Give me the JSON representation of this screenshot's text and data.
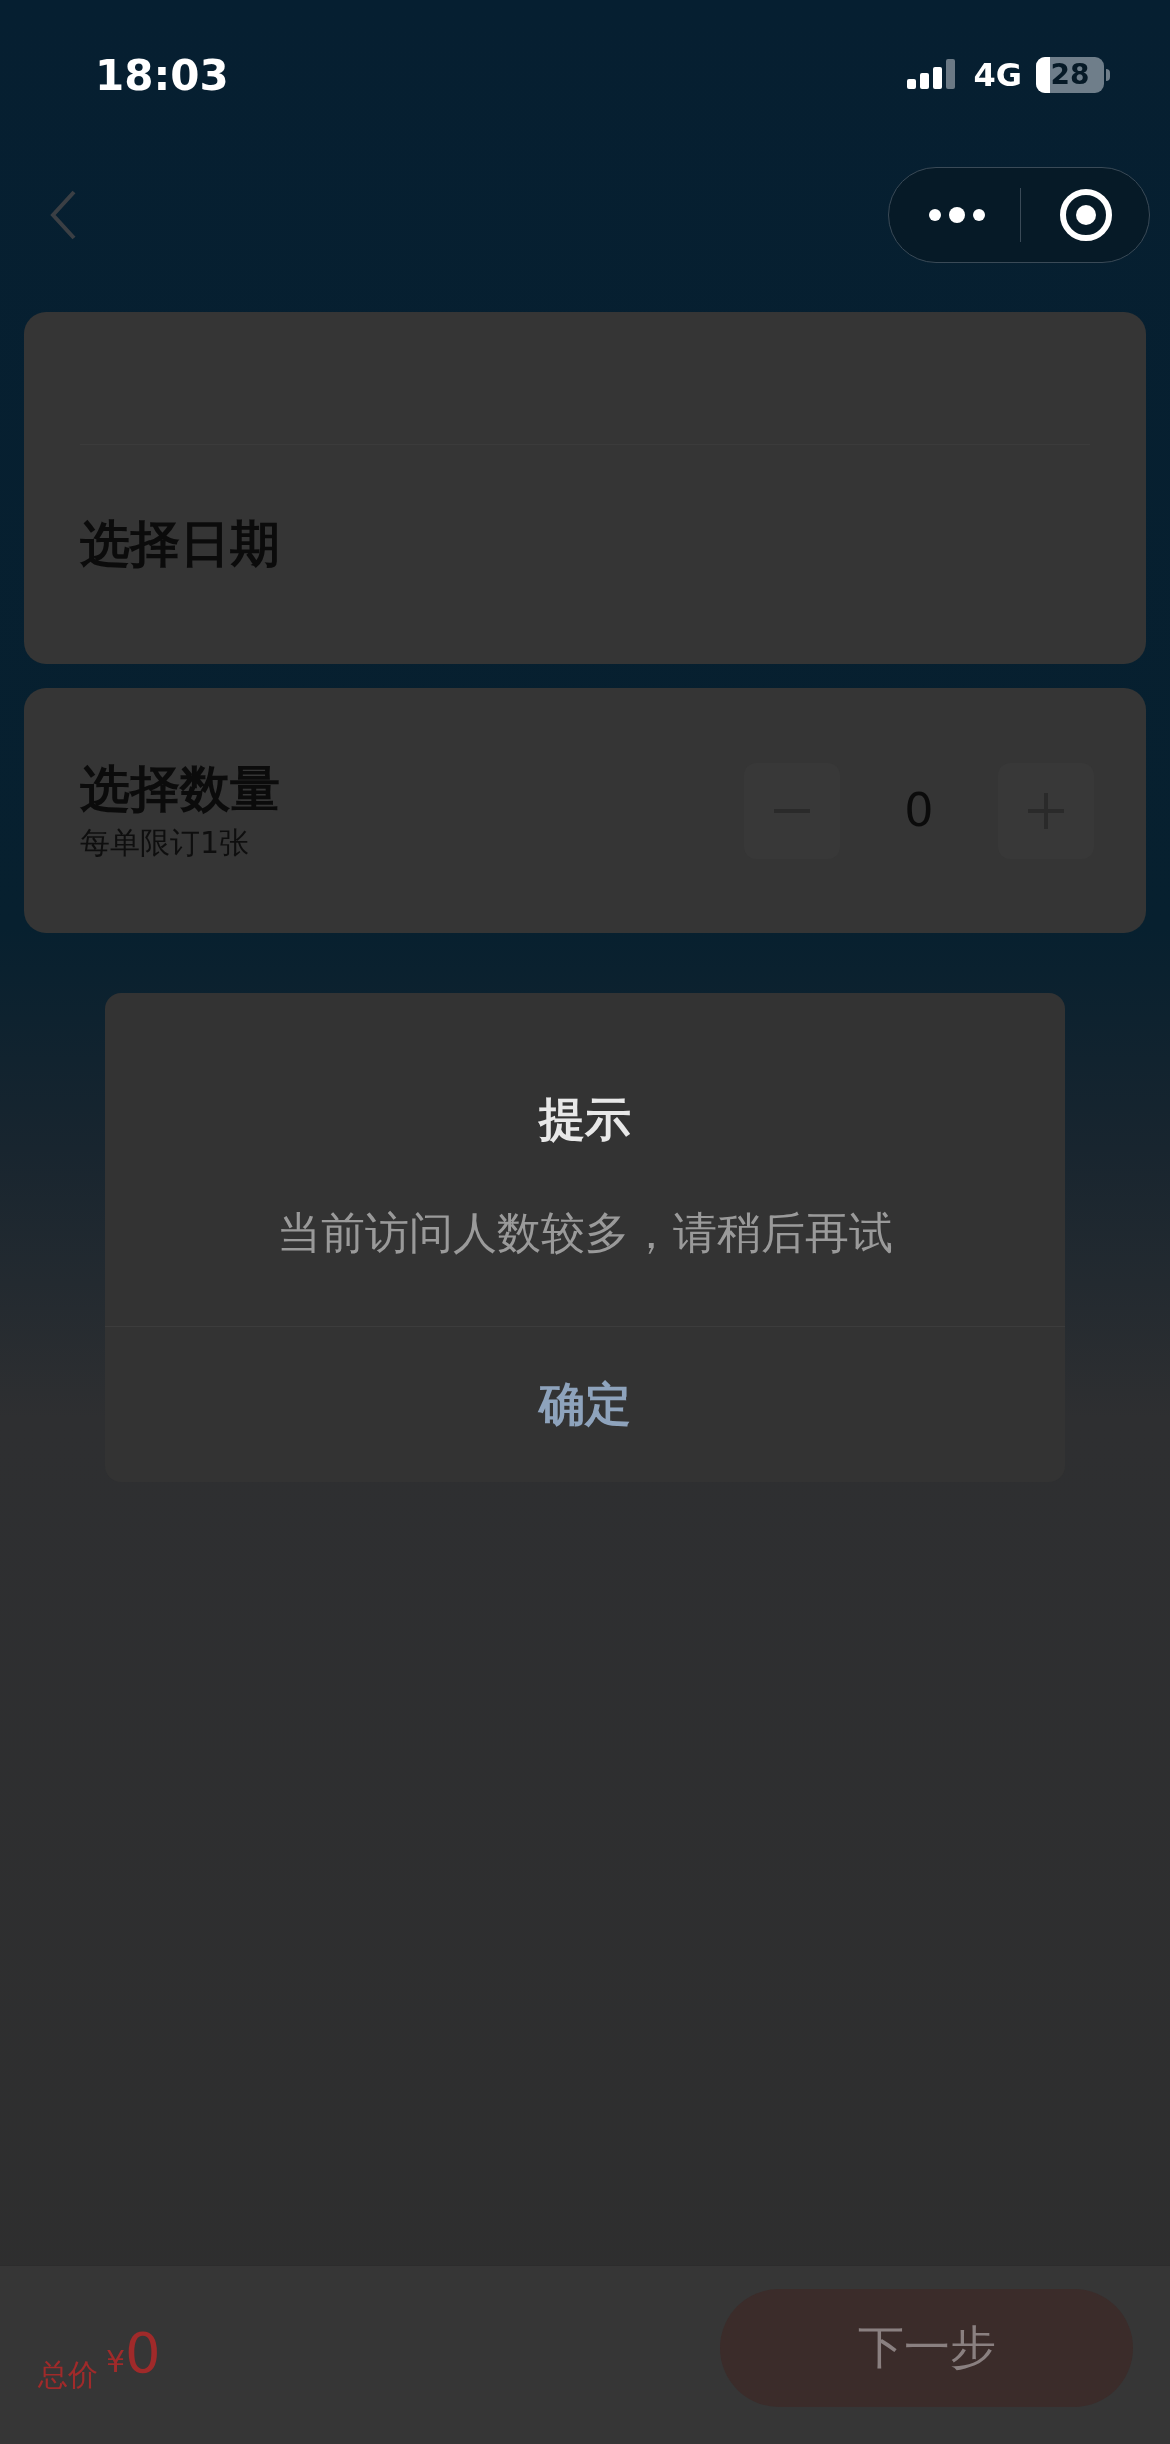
{
  "status_bar": {
    "time": "18:03",
    "network": "4G",
    "battery": "28"
  },
  "date_card": {
    "title": "选择日期"
  },
  "quantity_card": {
    "title": "选择数量",
    "note": "每单限订1张",
    "value": "0"
  },
  "dialog": {
    "title": "提示",
    "message": "当前访问人数较多，请稍后再试",
    "button": "确定"
  },
  "bottom_bar": {
    "total_label": "总价",
    "currency": "¥",
    "total": "0",
    "next_button": {
      "label": "下一步",
      "disabled": true
    }
  }
}
